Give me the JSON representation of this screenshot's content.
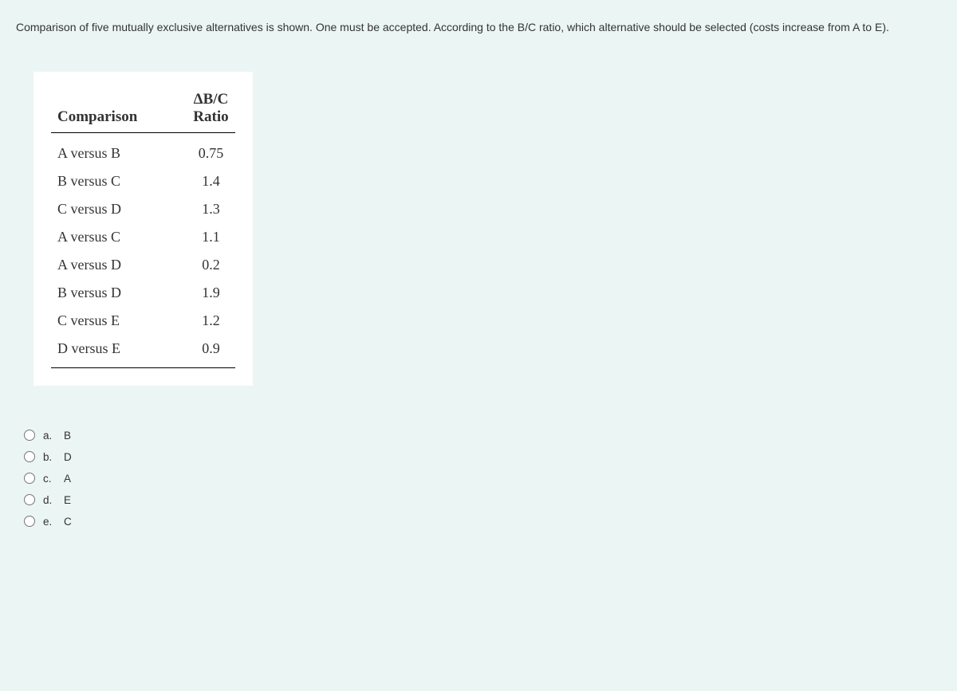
{
  "question": "Comparison of five mutually exclusive alternatives is shown. One must be accepted. According to the B/C ratio, which alternative should be selected (costs increase from A to E).",
  "table": {
    "headers": {
      "col1": "Comparison",
      "col2": "ΔB/C Ratio"
    },
    "rows": [
      {
        "comparison": "A versus B",
        "ratio": "0.75"
      },
      {
        "comparison": "B versus C",
        "ratio": "1.4"
      },
      {
        "comparison": "C versus D",
        "ratio": "1.3"
      },
      {
        "comparison": "A versus C",
        "ratio": "1.1"
      },
      {
        "comparison": "A versus D",
        "ratio": "0.2"
      },
      {
        "comparison": "B versus D",
        "ratio": "1.9"
      },
      {
        "comparison": "C versus E",
        "ratio": "1.2"
      },
      {
        "comparison": "D versus E",
        "ratio": "0.9"
      }
    ]
  },
  "options": [
    {
      "letter": "a.",
      "text": "B"
    },
    {
      "letter": "b.",
      "text": "D"
    },
    {
      "letter": "c.",
      "text": "A"
    },
    {
      "letter": "d.",
      "text": "E"
    },
    {
      "letter": "e.",
      "text": "C"
    }
  ]
}
